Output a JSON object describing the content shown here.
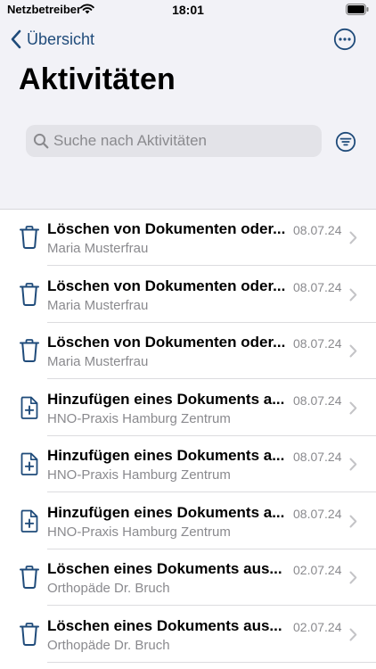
{
  "status_bar": {
    "carrier": "Netzbetreiber",
    "time": "18:01",
    "icons": [
      "wifi-icon",
      "battery-icon"
    ]
  },
  "nav": {
    "back_label": "Übersicht",
    "more_icon": "ellipsis-circle-icon"
  },
  "page": {
    "title": "Aktivitäten"
  },
  "search": {
    "placeholder": "Suche nach Aktivitäten",
    "value": "",
    "filter_icon": "filter-icon"
  },
  "colors": {
    "accent": "#1f4b7a",
    "background": "#f2f2f7",
    "secondary_text": "#8a8a8e"
  },
  "activities": [
    {
      "icon": "trash-icon",
      "title": "Löschen von Dokumenten oder...",
      "subtitle": "Maria Musterfrau",
      "date": "08.07.24"
    },
    {
      "icon": "trash-icon",
      "title": "Löschen von Dokumenten oder...",
      "subtitle": "Maria Musterfrau",
      "date": "08.07.24"
    },
    {
      "icon": "trash-icon",
      "title": "Löschen von Dokumenten oder...",
      "subtitle": "Maria Musterfrau",
      "date": "08.07.24"
    },
    {
      "icon": "document-add-icon",
      "title": "Hinzufügen eines Dokuments a...",
      "subtitle": "HNO-Praxis Hamburg Zentrum",
      "date": "08.07.24"
    },
    {
      "icon": "document-add-icon",
      "title": "Hinzufügen eines Dokuments a...",
      "subtitle": "HNO-Praxis Hamburg Zentrum",
      "date": "08.07.24"
    },
    {
      "icon": "document-add-icon",
      "title": "Hinzufügen eines Dokuments a...",
      "subtitle": "HNO-Praxis Hamburg Zentrum",
      "date": "08.07.24"
    },
    {
      "icon": "trash-icon",
      "title": "Löschen eines Dokuments aus...",
      "subtitle": "Orthopäde Dr. Bruch",
      "date": "02.07.24"
    },
    {
      "icon": "trash-icon",
      "title": "Löschen eines Dokuments aus...",
      "subtitle": "Orthopäde Dr. Bruch",
      "date": "02.07.24"
    }
  ]
}
